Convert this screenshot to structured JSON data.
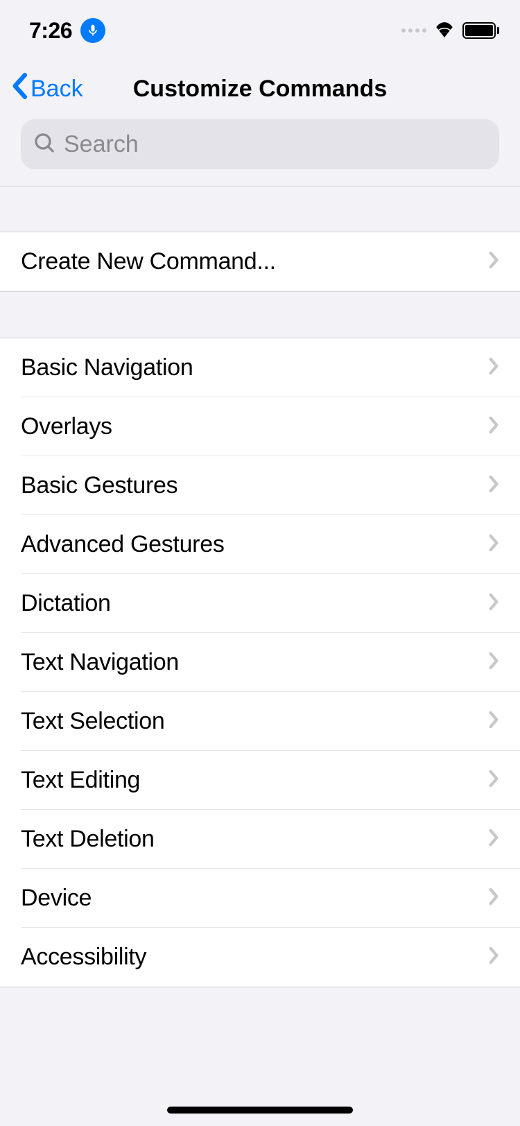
{
  "status": {
    "time": "7:26"
  },
  "nav": {
    "back_label": "Back",
    "title": "Customize Commands"
  },
  "search": {
    "placeholder": "Search"
  },
  "section_create": {
    "label": "Create New Command..."
  },
  "categories": [
    {
      "label": "Basic Navigation"
    },
    {
      "label": "Overlays"
    },
    {
      "label": "Basic Gestures"
    },
    {
      "label": "Advanced Gestures"
    },
    {
      "label": "Dictation"
    },
    {
      "label": "Text Navigation"
    },
    {
      "label": "Text Selection"
    },
    {
      "label": "Text Editing"
    },
    {
      "label": "Text Deletion"
    },
    {
      "label": "Device"
    },
    {
      "label": "Accessibility"
    }
  ]
}
